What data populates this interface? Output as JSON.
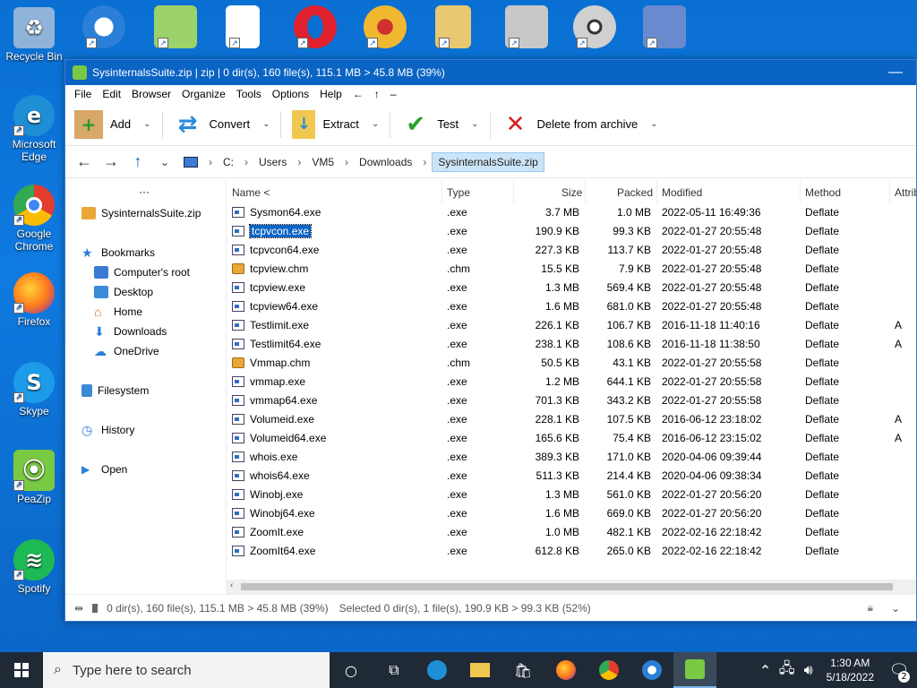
{
  "desktop": {
    "left_icons": [
      {
        "label": "Recycle Bin",
        "icon": "recycle-bin-icon",
        "color": "#8fb3d9"
      },
      {
        "label": "Microsoft Edge",
        "icon": "edge-icon",
        "color": "#1e8fd6"
      },
      {
        "label": "Google Chrome",
        "icon": "chrome-icon",
        "color": "#e33b2e"
      },
      {
        "label": "Firefox",
        "icon": "firefox-icon",
        "color": "#ff7b1c"
      },
      {
        "label": "Skype",
        "icon": "skype-icon",
        "color": "#1c9ce8"
      },
      {
        "label": "PeaZip",
        "icon": "peazip-icon",
        "color": "#7ac943"
      },
      {
        "label": "Spotify",
        "icon": "spotify-icon",
        "color": "#1db954"
      }
    ],
    "top_icons": [
      {
        "icon": "glary-utilities-icon",
        "color": "#2a7fd8"
      },
      {
        "icon": "notepad-plus-plus-icon",
        "color": "#9bd26a"
      },
      {
        "icon": "blank-document-icon",
        "color": "#ffffff"
      },
      {
        "icon": "opera-icon",
        "color": "#e0202c"
      },
      {
        "icon": "xnview-icon",
        "color": "#f0b830"
      },
      {
        "icon": "documents-folder-icon",
        "color": "#e8c870"
      },
      {
        "icon": "installer-shield-icon",
        "color": "#c8c8c8"
      },
      {
        "icon": "disc-icon",
        "color": "#d0d0d0"
      },
      {
        "icon": "putty-icon",
        "color": "#6a8ad0"
      }
    ]
  },
  "window": {
    "title": "SysinternalsSuite.zip | zip | 0 dir(s), 160 file(s), 115.1 MB > 45.8 MB (39%)",
    "menu": [
      "File",
      "Edit",
      "Browser",
      "Organize",
      "Tools",
      "Options",
      "Help",
      "←",
      "↑",
      "–"
    ],
    "toolbar": {
      "add": "Add",
      "convert": "Convert",
      "extract": "Extract",
      "test": "Test",
      "delete": "Delete from archive"
    },
    "address": {
      "root": "C:",
      "path": [
        "Users",
        "VM5",
        "Downloads"
      ],
      "current": "SysinternalsSuite.zip"
    },
    "sidebar": {
      "more": "···",
      "archive": "SysinternalsSuite.zip",
      "bookmarks": "Bookmarks",
      "bookmark_items": [
        "Computer's root",
        "Desktop",
        "Home",
        "Downloads",
        "OneDrive"
      ],
      "filesystem": "Filesystem",
      "history": "History",
      "open": "Open"
    },
    "columns": {
      "name": "Name <",
      "type": "Type",
      "size": "Size",
      "packed": "Packed",
      "modified": "Modified",
      "method": "Method",
      "attrib": "Attrib"
    },
    "files": [
      {
        "name": "Sysmon64.exe",
        "type": ".exe",
        "size": "3.7 MB",
        "packed": "1.0 MB",
        "modified": "2022-05-11 16:49:36",
        "method": "Deflate",
        "attrib": "",
        "kind": "exe"
      },
      {
        "name": "tcpvcon.exe",
        "type": ".exe",
        "size": "190.9 KB",
        "packed": "99.3 KB",
        "modified": "2022-01-27 20:55:48",
        "method": "Deflate",
        "attrib": "",
        "kind": "exe",
        "selected": true
      },
      {
        "name": "tcpvcon64.exe",
        "type": ".exe",
        "size": "227.3 KB",
        "packed": "113.7 KB",
        "modified": "2022-01-27 20:55:48",
        "method": "Deflate",
        "attrib": "",
        "kind": "exe"
      },
      {
        "name": "tcpview.chm",
        "type": ".chm",
        "size": "15.5 KB",
        "packed": "7.9 KB",
        "modified": "2022-01-27 20:55:48",
        "method": "Deflate",
        "attrib": "",
        "kind": "chm"
      },
      {
        "name": "tcpview.exe",
        "type": ".exe",
        "size": "1.3 MB",
        "packed": "569.4 KB",
        "modified": "2022-01-27 20:55:48",
        "method": "Deflate",
        "attrib": "",
        "kind": "exe"
      },
      {
        "name": "tcpview64.exe",
        "type": ".exe",
        "size": "1.6 MB",
        "packed": "681.0 KB",
        "modified": "2022-01-27 20:55:48",
        "method": "Deflate",
        "attrib": "",
        "kind": "exe"
      },
      {
        "name": "Testlimit.exe",
        "type": ".exe",
        "size": "226.1 KB",
        "packed": "106.7 KB",
        "modified": "2016-11-18 11:40:16",
        "method": "Deflate",
        "attrib": "A",
        "kind": "exe"
      },
      {
        "name": "Testlimit64.exe",
        "type": ".exe",
        "size": "238.1 KB",
        "packed": "108.6 KB",
        "modified": "2016-11-18 11:38:50",
        "method": "Deflate",
        "attrib": "A",
        "kind": "exe"
      },
      {
        "name": "Vmmap.chm",
        "type": ".chm",
        "size": "50.5 KB",
        "packed": "43.1 KB",
        "modified": "2022-01-27 20:55:58",
        "method": "Deflate",
        "attrib": "",
        "kind": "chm"
      },
      {
        "name": "vmmap.exe",
        "type": ".exe",
        "size": "1.2 MB",
        "packed": "644.1 KB",
        "modified": "2022-01-27 20:55:58",
        "method": "Deflate",
        "attrib": "",
        "kind": "exe"
      },
      {
        "name": "vmmap64.exe",
        "type": ".exe",
        "size": "701.3 KB",
        "packed": "343.2 KB",
        "modified": "2022-01-27 20:55:58",
        "method": "Deflate",
        "attrib": "",
        "kind": "exe"
      },
      {
        "name": "Volumeid.exe",
        "type": ".exe",
        "size": "228.1 KB",
        "packed": "107.5 KB",
        "modified": "2016-06-12 23:18:02",
        "method": "Deflate",
        "attrib": "A",
        "kind": "exe"
      },
      {
        "name": "Volumeid64.exe",
        "type": ".exe",
        "size": "165.6 KB",
        "packed": "75.4 KB",
        "modified": "2016-06-12 23:15:02",
        "method": "Deflate",
        "attrib": "A",
        "kind": "exe"
      },
      {
        "name": "whois.exe",
        "type": ".exe",
        "size": "389.3 KB",
        "packed": "171.0 KB",
        "modified": "2020-04-06 09:39:44",
        "method": "Deflate",
        "attrib": "",
        "kind": "exe"
      },
      {
        "name": "whois64.exe",
        "type": ".exe",
        "size": "511.3 KB",
        "packed": "214.4 KB",
        "modified": "2020-04-06 09:38:34",
        "method": "Deflate",
        "attrib": "",
        "kind": "exe"
      },
      {
        "name": "Winobj.exe",
        "type": ".exe",
        "size": "1.3 MB",
        "packed": "561.0 KB",
        "modified": "2022-01-27 20:56:20",
        "method": "Deflate",
        "attrib": "",
        "kind": "exe"
      },
      {
        "name": "Winobj64.exe",
        "type": ".exe",
        "size": "1.6 MB",
        "packed": "669.0 KB",
        "modified": "2022-01-27 20:56:20",
        "method": "Deflate",
        "attrib": "",
        "kind": "exe"
      },
      {
        "name": "ZoomIt.exe",
        "type": ".exe",
        "size": "1.0 MB",
        "packed": "482.1 KB",
        "modified": "2022-02-16 22:18:42",
        "method": "Deflate",
        "attrib": "",
        "kind": "exe"
      },
      {
        "name": "ZoomIt64.exe",
        "type": ".exe",
        "size": "612.8 KB",
        "packed": "265.0 KB",
        "modified": "2022-02-16 22:18:42",
        "method": "Deflate",
        "attrib": "",
        "kind": "exe"
      }
    ],
    "status": {
      "summary": "0 dir(s), 160 file(s), 115.1 MB > 45.8 MB (39%)",
      "selection": "Selected 0 dir(s), 1 file(s), 190.9 KB > 99.3 KB (52%)"
    }
  },
  "taskbar": {
    "search_placeholder": "Type here to search",
    "time": "1:30 AM",
    "date": "5/18/2022",
    "notifications": "2"
  }
}
